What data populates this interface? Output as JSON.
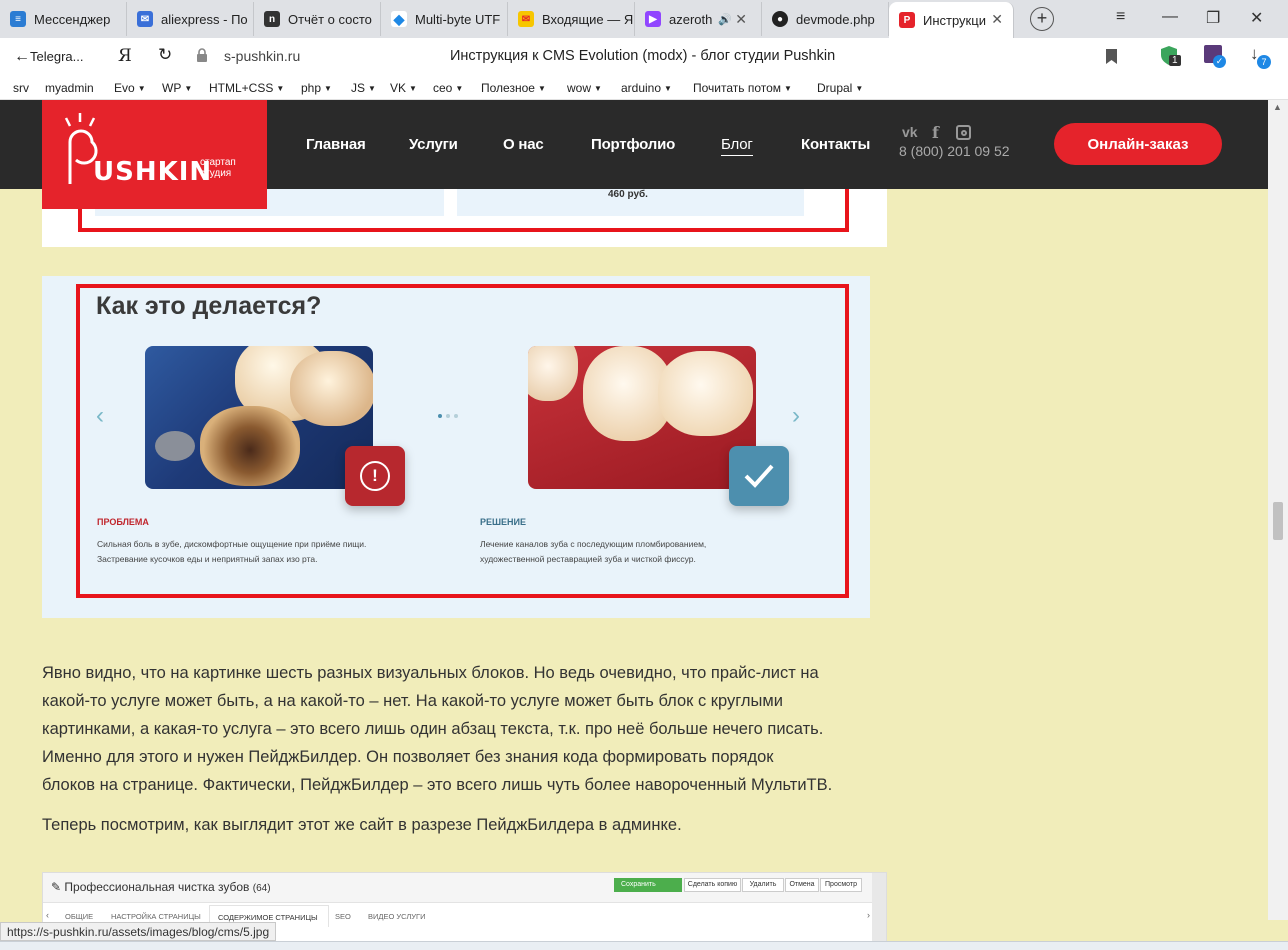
{
  "tabs": [
    {
      "label": "Мессенджер",
      "color": "#2b7cd3",
      "glyph": "≡"
    },
    {
      "label": "aliexpress - По",
      "color": "#3a6fd8",
      "glyph": "✉"
    },
    {
      "label": "Отчёт о состо",
      "color": "#333333",
      "glyph": "n"
    },
    {
      "label": "Multi-byte UTF",
      "color": "#1e88e5",
      "glyph": "◆"
    },
    {
      "label": "Входящие — Я",
      "color": "#f7c600",
      "glyph": "✉"
    },
    {
      "label": "azeroth",
      "color": "#9146ff",
      "glyph": "▶"
    },
    {
      "label": "devmode.php",
      "color": "#222222",
      "glyph": "●"
    },
    {
      "label": "Инструкци",
      "color": "#e5232b",
      "glyph": "P"
    }
  ],
  "address": {
    "back_label": "Telegra...",
    "domain": "s-pushkin.ru",
    "page_title": "Инструкция к CMS Evolution (modx) - блог студии Pushkin",
    "ext_badge_1": "1",
    "ext_badge_2": "7"
  },
  "bookmarks": [
    {
      "label": "srv",
      "dropdown": false
    },
    {
      "label": "myadmin",
      "dropdown": false
    },
    {
      "label": "Evo",
      "dropdown": true
    },
    {
      "label": "WP",
      "dropdown": true
    },
    {
      "label": "HTML+CSS",
      "dropdown": true
    },
    {
      "label": "php",
      "dropdown": true
    },
    {
      "label": "JS",
      "dropdown": true
    },
    {
      "label": "VK",
      "dropdown": true
    },
    {
      "label": "сео",
      "dropdown": true
    },
    {
      "label": "Полезное",
      "dropdown": true
    },
    {
      "label": "wow",
      "dropdown": true
    },
    {
      "label": "arduino",
      "dropdown": true
    },
    {
      "label": "Почитать потом",
      "dropdown": true
    },
    {
      "label": "Drupal",
      "dropdown": true
    }
  ],
  "site": {
    "logo_word": "USHKIN",
    "logo_sub_1": "стартап",
    "logo_sub_2": "студия",
    "nav": [
      "Главная",
      "Услуги",
      "О нас",
      "Портфолио",
      "Блог",
      "Контакты"
    ],
    "active_nav": "Блог",
    "phone": "8 (800) 201 09 52",
    "order_button": "Онлайн-заказ",
    "social_icons": [
      "vk-icon",
      "facebook-icon",
      "instagram-icon"
    ]
  },
  "article": {
    "top_image_price": "460 руб.",
    "figure": {
      "heading": "Как это делается?",
      "problem_label": "ПРОБЛЕМА",
      "problem_text_1": "Сильная боль в зубе, дискомфортные ощущение при приёме пищи.",
      "problem_text_2": "Застревание кусочков еды и неприятный запах изо рта.",
      "solution_label": "РЕШЕНИЕ",
      "solution_text_1": "Лечение каналов зуба с последующим пломбированием,",
      "solution_text_2": "художественной реставрацией зуба и чисткой фиссур."
    },
    "paragraph_1_lines": [
      "Явно видно, что на картинке шесть разных визуальных блоков. Но ведь очевидно, что прайс-лист на",
      "какой-то услуге может быть, а на какой-то – нет. На какой-то услуге может быть блок с круглыми",
      "картинками, а какая-то услуга – это всего лишь один абзац текста, т.к. про неё больше нечего писать.",
      "Именно для этого и нужен ПейджБилдер. Он позволяет без знания кода формировать порядок",
      "блоков на странице. Фактически, ПейджБилдер – это всего лишь чуть более навороченный МультиТВ."
    ],
    "paragraph_2": "Теперь посмотрим, как выглядит этот же сайт в разрезе ПейджБилдера в админке.",
    "admin_shot": {
      "title": "Профессиональная чистка зубов",
      "id_count": "(64)",
      "save": "Сохранить",
      "copy": "Сделать копию",
      "delete": "Удалить",
      "cancel": "Отмена",
      "view": "Просмотр",
      "tabs": [
        "ОБЩИЕ",
        "НАСТРОЙКА СТРАНИЦЫ",
        "СОДЕРЖИМОЕ СТРАНИЦЫ",
        "SEO",
        "ВИДЕО УСЛУГИ"
      ]
    }
  },
  "status_url": "https://s-pushkin.ru/assets/images/blog/cms/5.jpg"
}
